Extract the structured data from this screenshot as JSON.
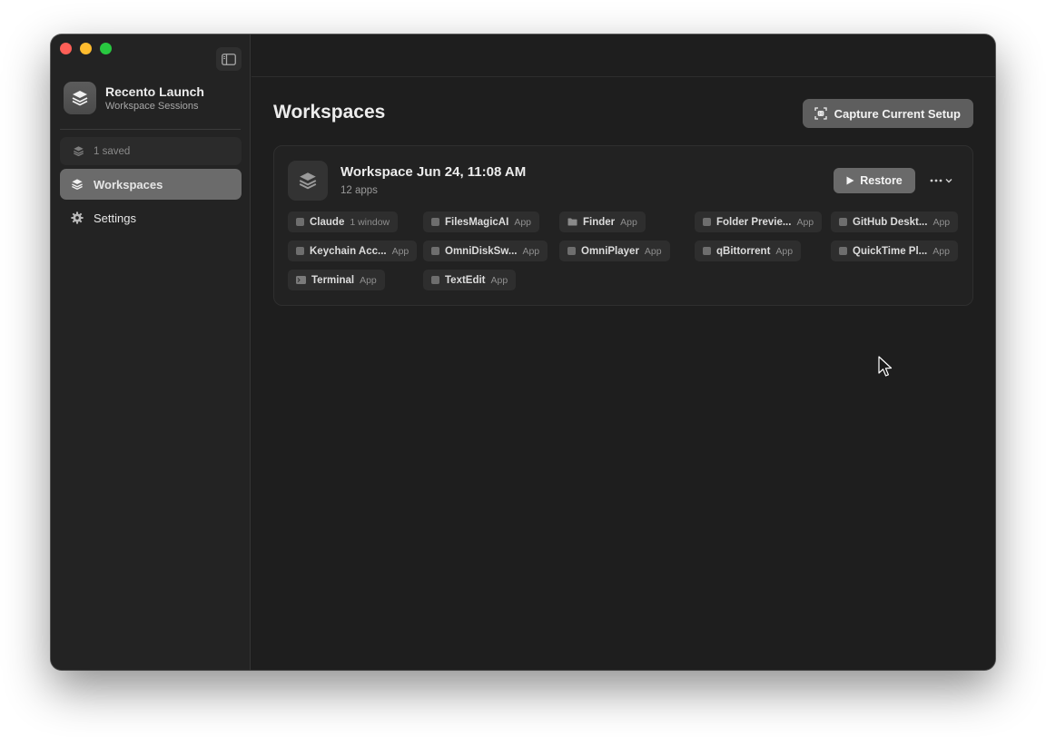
{
  "sidebar": {
    "app_name": "Recento Launch",
    "app_subtitle": "Workspace Sessions",
    "saved_label": "1 saved",
    "items": [
      {
        "label": "Workspaces",
        "icon": "stack-icon",
        "active": true
      },
      {
        "label": "Settings",
        "icon": "gear-icon",
        "active": false
      }
    ]
  },
  "main": {
    "title": "Workspaces",
    "capture_button": "Capture Current Setup",
    "workspace": {
      "name": "Workspace Jun 24, 11:08 AM",
      "count": "12 apps",
      "restore_label": "Restore",
      "more_label": "···",
      "apps": [
        {
          "name": "Claude",
          "kind": "1 window"
        },
        {
          "name": "FilesMagicAI",
          "kind": "App"
        },
        {
          "name": "Finder",
          "kind": "App"
        },
        {
          "name": "Folder Previe...",
          "kind": "App"
        },
        {
          "name": "GitHub Deskt...",
          "kind": "App"
        },
        {
          "name": "Keychain Acc...",
          "kind": "App"
        },
        {
          "name": "OmniDiskSw...",
          "kind": "App"
        },
        {
          "name": "OmniPlayer",
          "kind": "App"
        },
        {
          "name": "qBittorrent",
          "kind": "App"
        },
        {
          "name": "QuickTime Pl...",
          "kind": "App"
        },
        {
          "name": "Terminal",
          "kind": "App"
        },
        {
          "name": "TextEdit",
          "kind": "App"
        }
      ]
    }
  },
  "colors": {
    "window_bg": "#1e1e1e",
    "sidebar_bg": "#232323",
    "active_nav": "#6b6b6b",
    "close": "#ff5f57",
    "minimize": "#febc2e",
    "maximize": "#28c840"
  }
}
